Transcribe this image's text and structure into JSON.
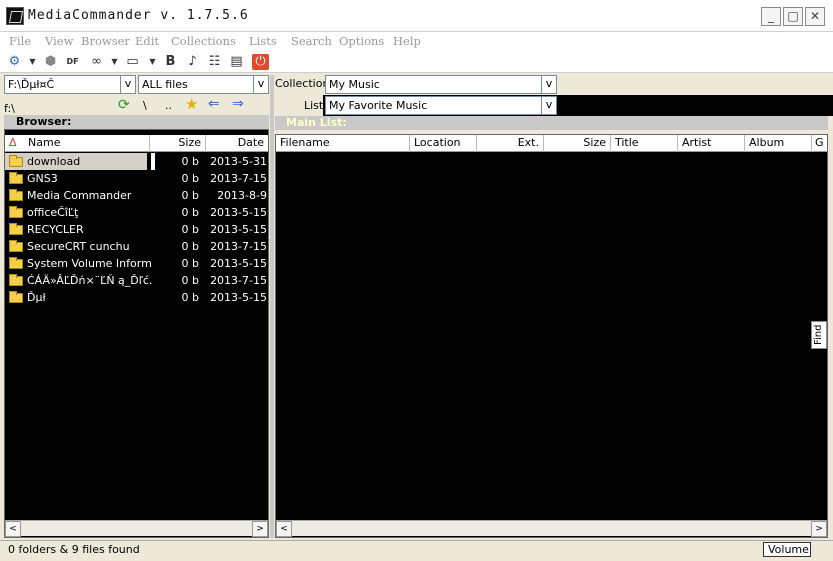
{
  "window": {
    "title": "MediaCommander v. 1.7.5.6",
    "minimize": "_",
    "maximize": "□",
    "close": "✕"
  },
  "menu": [
    "File",
    "View",
    "Browser",
    "Edit",
    "Collections",
    "Lists",
    "Search",
    "Options",
    "Help"
  ],
  "toolbar": {
    "icons": [
      "settings-gear-icon",
      "disc-icon",
      "dfs-icon",
      "binoculars-icon",
      "window-icon",
      "tag-b-icon",
      "search-music-icon",
      "tree-icon",
      "book-icon",
      "power-icon"
    ]
  },
  "browser": {
    "drive": "F:\\Ďµł¤Č",
    "drive_btn": "v",
    "filter": "ALL files",
    "filter_btn": "v",
    "path": "f:\\",
    "nav_icons": [
      "refresh-icon",
      "root-icon",
      "up-icon",
      "favorite-star-icon",
      "back-icon",
      "forward-icon"
    ],
    "nav_root": "\\",
    "nav_up": "..",
    "title": "Browser:",
    "columns": {
      "sort": "Δ",
      "name": "Name",
      "size": "Size",
      "date": "Date"
    },
    "rows": [
      {
        "name": "download",
        "size": "0 b",
        "date": "2013-5-31"
      },
      {
        "name": "GNS3",
        "size": "0 b",
        "date": "2013-7-15"
      },
      {
        "name": "Media Commander",
        "size": "0 b",
        "date": "2013-8-9"
      },
      {
        "name": "officeČîĽţ",
        "size": "0 b",
        "date": "2013-5-15"
      },
      {
        "name": "RECYCLER",
        "size": "0 b",
        "date": "2013-5-15"
      },
      {
        "name": "SecureCRT cunchu",
        "size": "0 b",
        "date": "2013-7-15"
      },
      {
        "name": "System Volume Inform...",
        "size": "0 b",
        "date": "2013-5-15"
      },
      {
        "name": "ĆÁÄ»ÂĽĎń×¨ĽŇ ą_Ďľć...",
        "size": "0 b",
        "date": "2013-7-15"
      },
      {
        "name": "Ďµł",
        "size": "0 b",
        "date": "2013-5-15"
      }
    ]
  },
  "collection": {
    "label": "Collection:",
    "value": "My Music",
    "btn": "v",
    "list_label": "List:",
    "list_value": "My Favorite Music",
    "list_btn": "v",
    "main_title": "Main List:",
    "columns": [
      "Filename",
      "Location",
      "Ext.",
      "Size",
      "Title",
      "Artist",
      "Album",
      "G"
    ],
    "find": "Find"
  },
  "scroll": {
    "left": "<",
    "right": ">"
  },
  "status": {
    "text": "0 folders & 9 files found",
    "volume": "Volume"
  }
}
